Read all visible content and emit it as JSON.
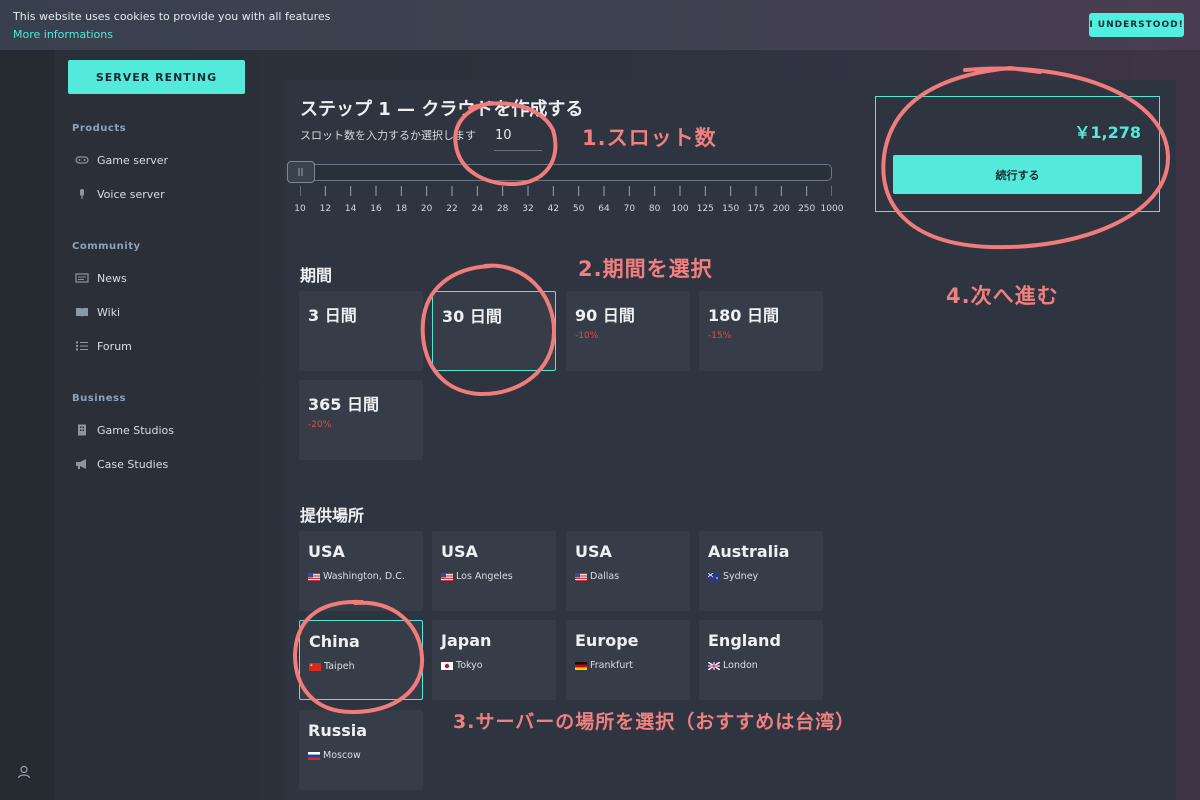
{
  "cookie": {
    "text": "This website uses cookies to provide you with all features",
    "link": "More informations",
    "button": "I UNDERSTOOD!"
  },
  "sidebar": {
    "button": "SERVER RENTING",
    "sections": [
      {
        "title": "Products",
        "items": [
          {
            "label": "Game server",
            "icon": "gamepad-icon"
          },
          {
            "label": "Voice server",
            "icon": "microphone-icon"
          }
        ]
      },
      {
        "title": "Community",
        "items": [
          {
            "label": "News",
            "icon": "newspaper-icon"
          },
          {
            "label": "Wiki",
            "icon": "book-icon"
          },
          {
            "label": "Forum",
            "icon": "list-icon"
          }
        ]
      },
      {
        "title": "Business",
        "items": [
          {
            "label": "Game Studios",
            "icon": "building-icon"
          },
          {
            "label": "Case Studies",
            "icon": "megaphone-icon"
          }
        ]
      }
    ]
  },
  "main": {
    "title": "ステップ 1 — クラウドを作成する",
    "slot_label": "スロット数を入力するか選択します",
    "slot_value": "10",
    "slider_fraction": 0,
    "slot_ticks": [
      "10",
      "12",
      "14",
      "16",
      "18",
      "20",
      "22",
      "24",
      "28",
      "32",
      "42",
      "50",
      "64",
      "70",
      "80",
      "100",
      "125",
      "150",
      "175",
      "200",
      "250",
      "1000"
    ],
    "period_heading": "期間",
    "periods": [
      {
        "label": "3 日間",
        "discount": "",
        "selected": false
      },
      {
        "label": "30 日間",
        "discount": "",
        "selected": true
      },
      {
        "label": "90 日間",
        "discount": "-10%",
        "selected": false
      },
      {
        "label": "180 日間",
        "discount": "-15%",
        "selected": false
      },
      {
        "label": "365 日間",
        "discount": "-20%",
        "selected": false
      }
    ],
    "location_heading": "提供場所",
    "locations": [
      {
        "country": "USA",
        "city": "Washington, D.C.",
        "flag": "us",
        "selected": false
      },
      {
        "country": "USA",
        "city": "Los Angeles",
        "flag": "us",
        "selected": false
      },
      {
        "country": "USA",
        "city": "Dallas",
        "flag": "us",
        "selected": false
      },
      {
        "country": "Australia",
        "city": "Sydney",
        "flag": "au",
        "selected": false
      },
      {
        "country": "China",
        "city": "Taipeh",
        "flag": "cn",
        "selected": true
      },
      {
        "country": "Japan",
        "city": "Tokyo",
        "flag": "jp",
        "selected": false
      },
      {
        "country": "Europe",
        "city": "Frankfurt",
        "flag": "de",
        "selected": false
      },
      {
        "country": "England",
        "city": "London",
        "flag": "gb",
        "selected": false
      },
      {
        "country": "Russia",
        "city": "Moscow",
        "flag": "ru",
        "selected": false
      }
    ],
    "price": "￥1,278",
    "continue": "続行する"
  },
  "annotations": {
    "a1": "1.スロット数",
    "a2": "2.期間を選択",
    "a3": "3.サーバーの場所を選択（おすすめは台湾）",
    "a4": "4.次へ進む"
  },
  "colors": {
    "accent": "#53eadb",
    "discount": "#e0484f",
    "annotation": "#f08080"
  }
}
